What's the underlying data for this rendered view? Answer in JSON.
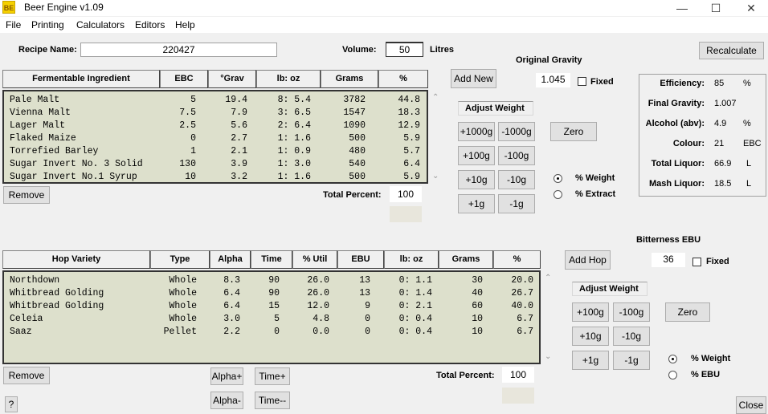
{
  "window": {
    "title": "Beer Engine v1.09",
    "icon_text": "BE"
  },
  "menu": [
    "File",
    "Printing",
    "Calculators",
    "Editors",
    "Help"
  ],
  "recipe": {
    "label": "Recipe Name:",
    "value": "220427"
  },
  "volume": {
    "label": "Volume:",
    "value": "50",
    "unit": "Litres"
  },
  "recalculate_label": "Recalculate",
  "gravity": {
    "title": "Original Gravity",
    "add_new": "Add New",
    "value": "1.045",
    "fixed_label": "Fixed"
  },
  "fermentables": {
    "headers": [
      "Fermentable Ingredient",
      "EBC",
      "°Grav",
      "lb: oz",
      "Grams",
      "%"
    ],
    "rows": [
      {
        "name": "Pale Malt",
        "ebc": "5",
        "grav": "19.4",
        "lboz": "8: 5.4",
        "grams": "3782",
        "pct": "44.8"
      },
      {
        "name": "Vienna Malt",
        "ebc": "7.5",
        "grav": "7.9",
        "lboz": "3: 6.5",
        "grams": "1547",
        "pct": "18.3"
      },
      {
        "name": "Lager Malt",
        "ebc": "2.5",
        "grav": "5.6",
        "lboz": "2: 6.4",
        "grams": "1090",
        "pct": "12.9"
      },
      {
        "name": "Flaked Maize",
        "ebc": "0",
        "grav": "2.7",
        "lboz": "1: 1.6",
        "grams": "500",
        "pct": "5.9"
      },
      {
        "name": "Torrefied Barley",
        "ebc": "1",
        "grav": "2.1",
        "lboz": "1: 0.9",
        "grams": "480",
        "pct": "5.7"
      },
      {
        "name": "Sugar Invert No. 3 Solid",
        "ebc": "130",
        "grav": "3.9",
        "lboz": "1: 3.0",
        "grams": "540",
        "pct": "6.4"
      },
      {
        "name": "Sugar Invert No.1 Syrup",
        "ebc": "10",
        "grav": "3.2",
        "lboz": "1: 1.6",
        "grams": "500",
        "pct": "5.9"
      }
    ],
    "remove_label": "Remove",
    "total_label": "Total Percent:",
    "total_value": "100"
  },
  "adjust_weight": {
    "title": "Adjust Weight",
    "buttons": [
      [
        "+1000g",
        "-1000g"
      ],
      [
        "+100g",
        "-100g"
      ],
      [
        "+10g",
        "-10g"
      ],
      [
        "+1g",
        "-1g"
      ]
    ],
    "zero_label": "Zero",
    "radio_weight": "% Weight",
    "radio_extract": "% Extract"
  },
  "stats": [
    {
      "label": "Efficiency:",
      "value": "85",
      "unit": "%"
    },
    {
      "label": "Final Gravity:",
      "value": "1.007",
      "unit": ""
    },
    {
      "label": "Alcohol (abv):",
      "value": "4.9",
      "unit": "%"
    },
    {
      "label": "Colour:",
      "value": "21",
      "unit": "EBC"
    },
    {
      "label": "Total Liquor:",
      "value": "66.9",
      "unit": "L"
    },
    {
      "label": "Mash Liquor:",
      "value": "18.5",
      "unit": "L"
    }
  ],
  "bitterness": {
    "title": "Bitterness EBU",
    "add_hop": "Add Hop",
    "value": "36",
    "fixed_label": "Fixed"
  },
  "hops": {
    "headers": [
      "Hop Variety",
      "Type",
      "Alpha",
      "Time",
      "% Util",
      "EBU",
      "lb: oz",
      "Grams",
      "%"
    ],
    "rows": [
      {
        "name": "Northdown",
        "type": "Whole",
        "alpha": "8.3",
        "time": "90",
        "util": "26.0",
        "ebu": "13",
        "lboz": "0: 1.1",
        "grams": "30",
        "pct": "20.0"
      },
      {
        "name": "Whitbread Golding",
        "type": "Whole",
        "alpha": "6.4",
        "time": "90",
        "util": "26.0",
        "ebu": "13",
        "lboz": "0: 1.4",
        "grams": "40",
        "pct": "26.7"
      },
      {
        "name": "Whitbread Golding",
        "type": "Whole",
        "alpha": "6.4",
        "time": "15",
        "util": "12.0",
        "ebu": "9",
        "lboz": "0: 2.1",
        "grams": "60",
        "pct": "40.0"
      },
      {
        "name": "Celeia",
        "type": "Whole",
        "alpha": "3.0",
        "time": "5",
        "util": "4.8",
        "ebu": "0",
        "lboz": "0: 0.4",
        "grams": "10",
        "pct": "6.7"
      },
      {
        "name": "Saaz",
        "type": "Pellet",
        "alpha": "2.2",
        "time": "0",
        "util": "0.0",
        "ebu": "0",
        "lboz": "0: 0.4",
        "grams": "10",
        "pct": "6.7"
      }
    ],
    "remove_label": "Remove",
    "alpha_plus": "Alpha+",
    "alpha_minus": "Alpha-",
    "time_plus": "Time+",
    "time_minus": "Time--",
    "total_label": "Total Percent:",
    "total_value": "100"
  },
  "hop_adjust": {
    "title": "Adjust Weight",
    "buttons": [
      [
        "+100g",
        "-100g"
      ],
      [
        "+10g",
        "-10g"
      ],
      [
        "+1g",
        "-1g"
      ]
    ],
    "zero_label": "Zero",
    "radio_weight": "% Weight",
    "radio_ebu": "% EBU"
  },
  "help_label": "?",
  "close_label": "Close"
}
